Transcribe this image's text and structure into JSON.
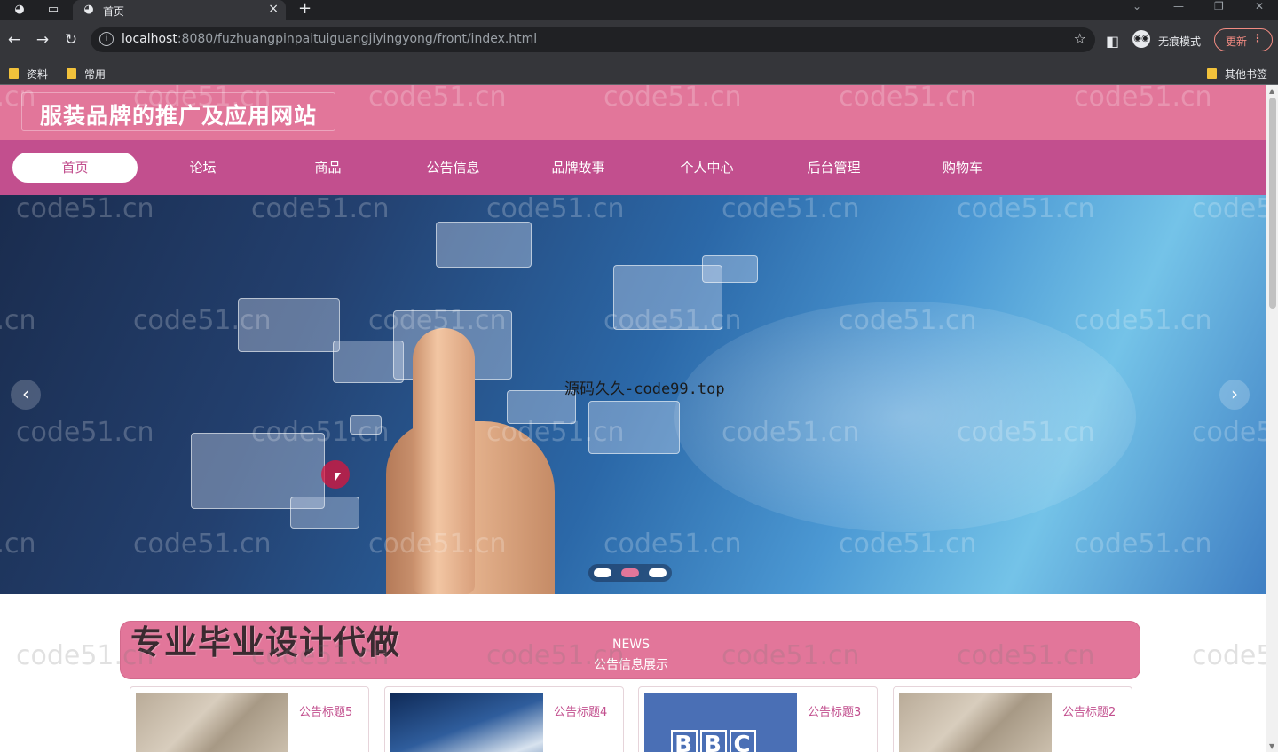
{
  "browser": {
    "tab_title": "首页",
    "url_host": "localhost",
    "url_rest": ":8080/fuzhuangpinpaituiguangjiyingyong/front/index.html",
    "incognito_label": "无痕模式",
    "update_label": "更新",
    "bookmarks": [
      "资料",
      "常用"
    ],
    "other_bookmarks": "其他书签"
  },
  "site": {
    "title": "服装品牌的推广及应用网站",
    "nav": [
      "首页",
      "论坛",
      "商品",
      "公告信息",
      "品牌故事",
      "个人中心",
      "后台管理",
      "购物车"
    ],
    "active_nav_index": 0
  },
  "banner": {
    "center_watermark": "源码久久-code99.top",
    "slide_count": 3,
    "active_slide": 2
  },
  "promo_overlay": "专业毕业设计代做",
  "news_section": {
    "title_en": "NEWS",
    "title_cn": "公告信息展示",
    "items": [
      {
        "title": "公告标题5",
        "thumb": "fabric"
      },
      {
        "title": "公告标题4",
        "thumb": "sky"
      },
      {
        "title": "公告标题3",
        "thumb": "bbc",
        "thumb_text": [
          "B",
          "B",
          "C"
        ]
      },
      {
        "title": "公告标题2",
        "thumb": "fabric"
      }
    ]
  },
  "watermark_text": "code51.cn",
  "colors": {
    "header_pink": "#e2769a",
    "nav_magenta": "#c24f8e",
    "chrome_dark": "#202124"
  }
}
